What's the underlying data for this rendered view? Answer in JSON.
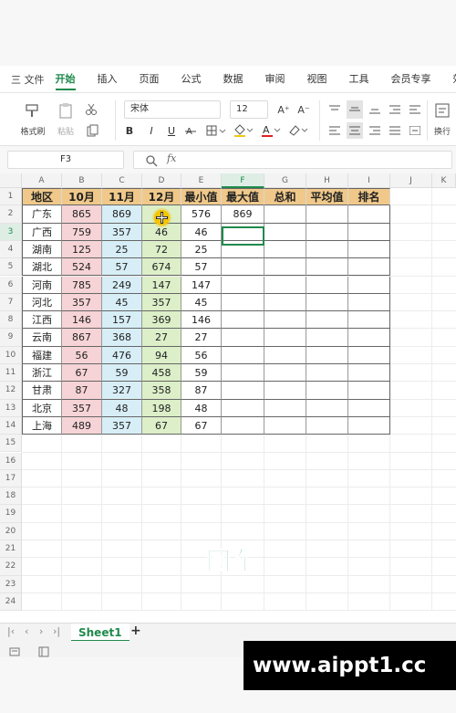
{
  "menu": {
    "file": "三 文件",
    "tabs": [
      {
        "label": "开始",
        "active": true
      },
      {
        "label": "插入",
        "active": false
      },
      {
        "label": "页面",
        "active": false
      },
      {
        "label": "公式",
        "active": false
      },
      {
        "label": "数据",
        "active": false
      },
      {
        "label": "审阅",
        "active": false
      },
      {
        "label": "视图",
        "active": false
      },
      {
        "label": "工具",
        "active": false
      },
      {
        "label": "会员专享",
        "active": false
      },
      {
        "label": "效",
        "active": false
      }
    ]
  },
  "ribbon": {
    "format_painter_label": "格式刷",
    "paste_label": "粘贴",
    "font_name": "宋体",
    "font_size": "12",
    "bold": "B",
    "italic": "I",
    "underline": "U",
    "grow_font": "A⁺",
    "shrink_font": "A⁻",
    "wrap_label": "换行"
  },
  "formula_bar": {
    "cell_ref": "F3",
    "fx": "fx"
  },
  "sheet": {
    "columns": [
      "A",
      "B",
      "C",
      "D",
      "E",
      "F",
      "G",
      "H",
      "I",
      "J",
      "K"
    ],
    "selected_column": "F",
    "selected_row": 3,
    "row_numbers": [
      "1",
      "2",
      "3",
      "4",
      "5",
      "6",
      "7",
      "8",
      "9",
      "10",
      "11",
      "12",
      "13",
      "14",
      "15",
      "16",
      "17",
      "18",
      "19",
      "20",
      "21",
      "22",
      "23",
      "24"
    ],
    "headers": [
      "地区",
      "10月",
      "11月",
      "12月",
      "最小值",
      "最大值",
      "总和",
      "平均值",
      "排名"
    ],
    "rows": [
      [
        "广东",
        "865",
        "869",
        "8",
        "576",
        "869",
        "",
        "",
        ""
      ],
      [
        "广西",
        "759",
        "357",
        "46",
        "46",
        "",
        "",
        "",
        ""
      ],
      [
        "湖南",
        "125",
        "25",
        "72",
        "25",
        "",
        "",
        "",
        ""
      ],
      [
        "湖北",
        "524",
        "57",
        "674",
        "57",
        "",
        "",
        "",
        ""
      ],
      [
        "河南",
        "785",
        "249",
        "147",
        "147",
        "",
        "",
        "",
        ""
      ],
      [
        "河北",
        "357",
        "45",
        "357",
        "45",
        "",
        "",
        "",
        ""
      ],
      [
        "江西",
        "146",
        "157",
        "369",
        "146",
        "",
        "",
        "",
        ""
      ],
      [
        "云南",
        "867",
        "368",
        "27",
        "27",
        "",
        "",
        "",
        ""
      ],
      [
        "福建",
        "56",
        "476",
        "94",
        "56",
        "",
        "",
        "",
        ""
      ],
      [
        "浙江",
        "67",
        "59",
        "458",
        "59",
        "",
        "",
        "",
        ""
      ],
      [
        "甘肃",
        "87",
        "327",
        "358",
        "87",
        "",
        "",
        "",
        ""
      ],
      [
        "北京",
        "357",
        "48",
        "198",
        "48",
        "",
        "",
        "",
        ""
      ],
      [
        "上海",
        "489",
        "357",
        "67",
        "67",
        "",
        "",
        "",
        ""
      ]
    ]
  },
  "colors": {
    "accent": "#1f8a4c",
    "header_fill": "#f0c98a",
    "col_b_fill": "#f6d3d6",
    "col_c_fill": "#d7eef6",
    "col_d_fill": "#dcefc8"
  },
  "sheet_tabs": {
    "active": "Sheet1",
    "add": "+"
  },
  "caption": "回车",
  "watermark": "www.aippt1.cc"
}
